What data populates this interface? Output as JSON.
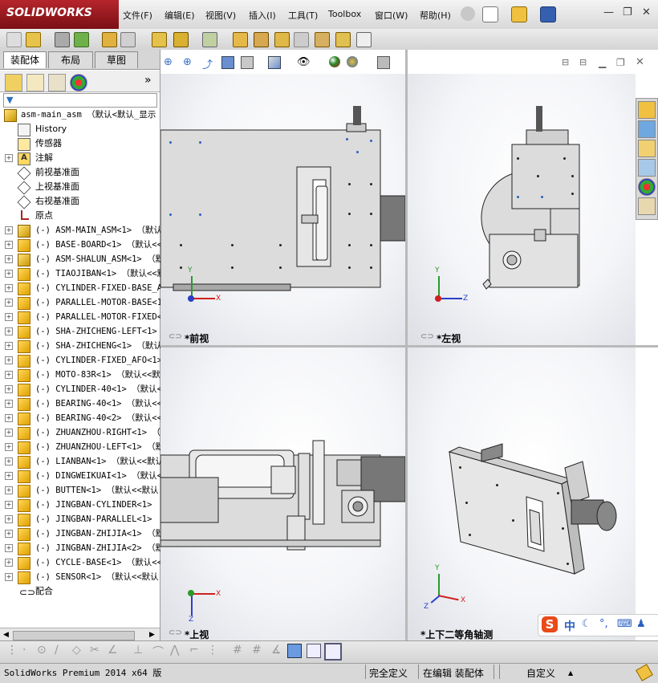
{
  "app": {
    "logo": "SOLIDWORKS",
    "brand_color": "#b5252b"
  },
  "menu": {
    "items": [
      {
        "label": "文件(F)"
      },
      {
        "label": "编辑(E)"
      },
      {
        "label": "视图(V)"
      },
      {
        "label": "插入(I)"
      },
      {
        "label": "工具(T)"
      },
      {
        "label": "Toolbox"
      },
      {
        "label": "窗口(W)"
      },
      {
        "label": "帮助(H)"
      }
    ]
  },
  "manager": {
    "tabs": [
      {
        "label": "装配体",
        "active": true
      },
      {
        "label": "布局",
        "active": false
      },
      {
        "label": "草图",
        "active": false
      }
    ],
    "filter_icon": "funnel-icon",
    "expand_glyph": "»"
  },
  "tree": {
    "root": "asm-main_asm （默认<默认_显示",
    "fixed_items": [
      {
        "label": "History",
        "icon": "history-icon"
      },
      {
        "label": "传感器",
        "icon": "sensor-icon"
      },
      {
        "label": "注解",
        "icon": "annotation-icon"
      },
      {
        "label": "前视基准面",
        "icon": "plane-icon"
      },
      {
        "label": "上视基准面",
        "icon": "plane-icon"
      },
      {
        "label": "右视基准面",
        "icon": "plane-icon"
      },
      {
        "label": "原点",
        "icon": "origin-icon"
      }
    ],
    "components": [
      {
        "label": "(-) ASM-MAIN_ASM<1> （默认<",
        "type": "asm"
      },
      {
        "label": "(-) BASE-BOARD<1> （默认<<",
        "type": "part"
      },
      {
        "label": "(-) ASM-SHALUN_ASM<1> （默",
        "type": "asm"
      },
      {
        "label": "(-) TIAOJIBAN<1> （默认<<默",
        "type": "part"
      },
      {
        "label": "(-) CYLINDER-FIXED-BASE_AN",
        "type": "part"
      },
      {
        "label": "(-) PARALLEL-MOTOR-BASE<1>",
        "type": "part"
      },
      {
        "label": "(-) PARALLEL-MOTOR-FIXED<",
        "type": "part"
      },
      {
        "label": "(-) SHA-ZHICHENG-LEFT<1>",
        "type": "part"
      },
      {
        "label": "(-) SHA-ZHICHENG<1> （默认<",
        "type": "part"
      },
      {
        "label": "(-) CYLINDER-FIXED_AFO<1>",
        "type": "part"
      },
      {
        "label": "(-) MOTO-83R<1> （默认<<默",
        "type": "part"
      },
      {
        "label": "(-) CYLINDER-40<1> （默认<",
        "type": "part"
      },
      {
        "label": "(-) BEARING-40<1> （默认<<9",
        "type": "part"
      },
      {
        "label": "(-) BEARING-40<2> （默认<<9",
        "type": "part"
      },
      {
        "label": "(-) ZHUANZHOU-RIGHT<1> （默",
        "type": "part"
      },
      {
        "label": "(-) ZHUANZHOU-LEFT<1> （默",
        "type": "part"
      },
      {
        "label": "(-) LIANBAN<1> （默认<<默认",
        "type": "part"
      },
      {
        "label": "(-) DINGWEIKUAI<1> （默认<",
        "type": "part"
      },
      {
        "label": "(-) BUTTEN<1> （默认<<默认",
        "type": "part"
      },
      {
        "label": "(-) JINGBAN-CYLINDER<1> （",
        "type": "part"
      },
      {
        "label": "(-) JINGBAN-PARALLEL<1> （",
        "type": "part"
      },
      {
        "label": "(-) JINGBAN-ZHIJIA<1> （默",
        "type": "part"
      },
      {
        "label": "(-) JINGBAN-ZHIJIA<2> （默",
        "type": "part"
      },
      {
        "label": "(-) CYCLE-BASE<1> （默认<<9",
        "type": "part"
      },
      {
        "label": "(-) SENSOR<1> （默认<<默认",
        "type": "part"
      }
    ],
    "mates": "配合"
  },
  "viewports": {
    "front": "*前视",
    "left": "*左视",
    "top": "*上视",
    "iso": "*上下二等角轴测",
    "axes": {
      "x": "X",
      "y": "Y",
      "z": "Z"
    }
  },
  "ime": {
    "logo": "S",
    "lang": "中",
    "icons": [
      "moon-icon",
      "punct-icon",
      "keyboard-icon",
      "user-icon"
    ]
  },
  "status": {
    "version": "SolidWorks Premium 2014 x64 版",
    "defined": "完全定义",
    "editing": "在编辑 装配体",
    "units": "自定义",
    "arrow": "▲"
  }
}
